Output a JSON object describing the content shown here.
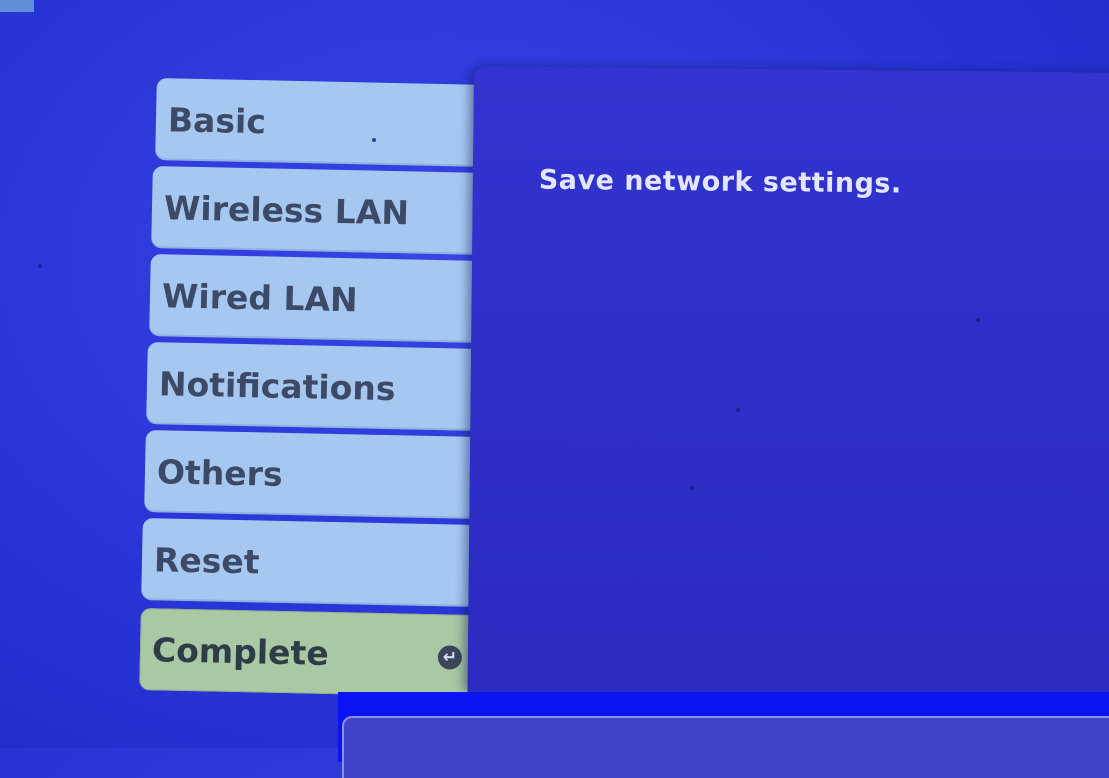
{
  "menu": {
    "items": [
      {
        "label": "Basic"
      },
      {
        "label": "Wireless LAN"
      },
      {
        "label": "Wired LAN"
      },
      {
        "label": "Notifications"
      },
      {
        "label": "Others"
      },
      {
        "label": "Reset"
      },
      {
        "label": "Complete",
        "selected": true,
        "icon": "enter-icon"
      }
    ]
  },
  "content": {
    "message": "Save network settings."
  },
  "colors": {
    "background": "#2a36d8",
    "menu_item": "#a6c8f0",
    "menu_item_selected": "#a9c9a4",
    "panel": "#2d2fc8",
    "text_light": "#e2e6ff"
  }
}
